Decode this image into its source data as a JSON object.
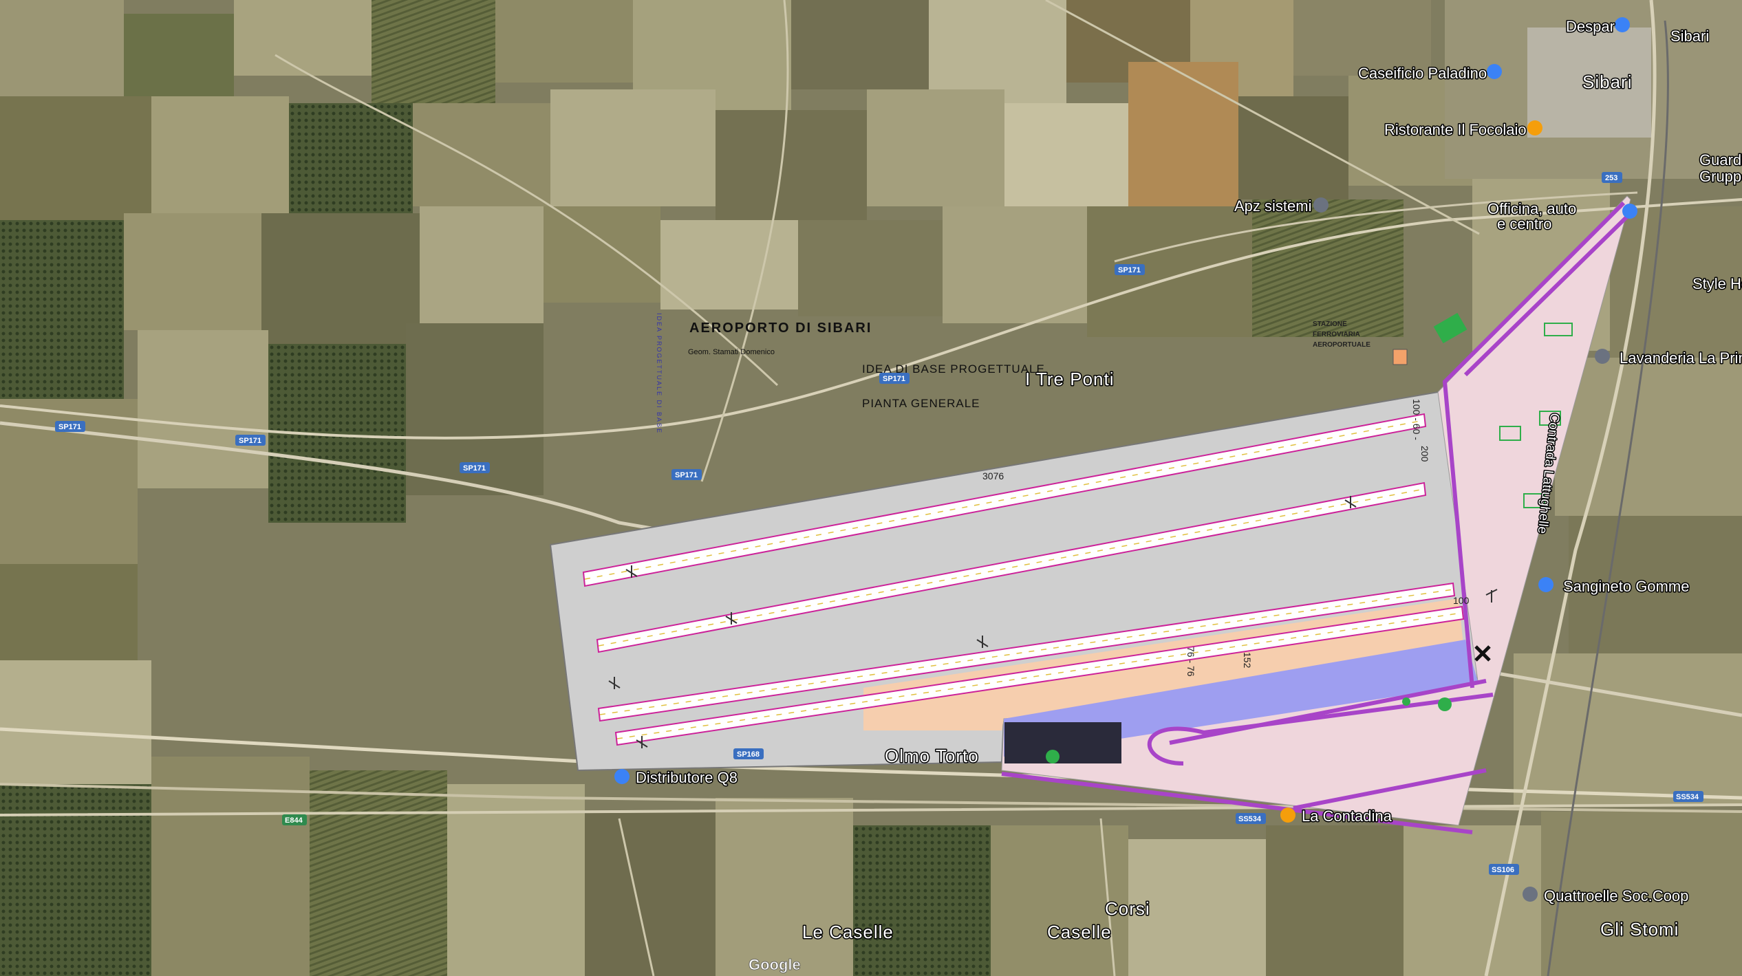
{
  "project": {
    "title": "AEROPORTO DI SIBARI",
    "author": "Geom. Stamati Domenico",
    "idea": "IDEA DI BASE PROGETTUALE",
    "plan": "PIANTA GENERALE",
    "vertical_text": "IDEA PROGETTUALE DI BASE",
    "station": [
      "STAZIONE",
      "FERROVIARIA",
      "AEROPORTUALE"
    ]
  },
  "dimensions": {
    "length": "3076",
    "end_width": "100 - 60 -",
    "side": "200",
    "apron": "100",
    "d1": "76 - 76",
    "d2": "152"
  },
  "places": {
    "despar": "Despar",
    "sibari_station": "Sibari",
    "sibari_town": "Sibari",
    "caseificio": "Caseificio Paladino",
    "ristorante": "Ristorante Il Focolaio",
    "guardia_1": "Guardi",
    "guardia_2": "Gruppo",
    "apz": "Apz sistemi",
    "officina_1": "Officina, auto",
    "officina_2": "e centro",
    "style": "Style Ho",
    "lavanderia": "Lavanderia La Primu",
    "sangineto": "Sangineto Gomme",
    "tre_ponti": "I Tre Ponti",
    "olmo": "Olmo Torto",
    "distributore": "Distributore Q8",
    "contadina": "La Contadina",
    "quattroelle": "Quattroelle Soc.Coop",
    "stomi": "Gli Stomi",
    "caselle1": "Le Caselle",
    "corsi": "Corsi",
    "caselle2": "Caselle",
    "contrada": "Contrada Lattughelle"
  },
  "roads": {
    "sp171_a": "SP171",
    "sp171_b": "SP171",
    "sp171_c": "SP171",
    "sp171_d": "SP171",
    "sp171_e": "SP171",
    "sp171_f": "SP171",
    "sp168": "SP168",
    "e844": "E844",
    "ss534_a": "SS534",
    "ss534_b": "SS534",
    "ss106": "SS106",
    "r253": "253"
  },
  "attribution": "Google",
  "colors": {
    "runway": "#ffffff",
    "runway_edge": "#cc2299",
    "taxiway_line": "#e0c040",
    "apron_grey": "#cfcfcf",
    "apron_orange": "#f6ceae",
    "terminal_pink": "#efd6dc",
    "terminal_blue": "#9e9ef0",
    "access_road": "#a844c8"
  }
}
